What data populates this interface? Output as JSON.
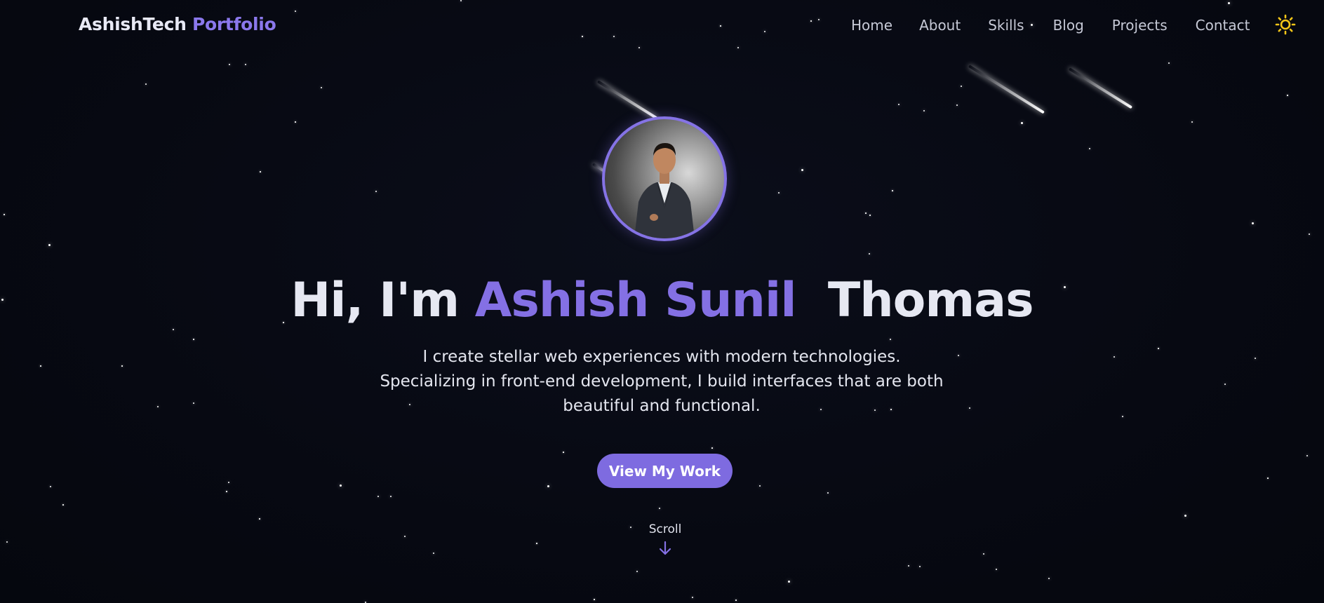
{
  "brand": {
    "part1": "AshishTech",
    "part2": "Portfolio"
  },
  "nav": {
    "items": [
      {
        "label": "Home"
      },
      {
        "label": "About"
      },
      {
        "label": "Skills"
      },
      {
        "label": "Blog"
      },
      {
        "label": "Projects"
      },
      {
        "label": "Contact"
      }
    ],
    "theme_icon": "sun-icon"
  },
  "hero": {
    "avatar_icon": "profile-photo",
    "title_prefix": "Hi, I'm ",
    "title_accent": "Ashish Sunil",
    "title_suffix": "Thomas",
    "description": "I create stellar web experiences with modern technologies. Specializing in front-end development, I build interfaces that are both beautiful and functional.",
    "cta_label": "View My Work",
    "scroll_label": "Scroll",
    "scroll_icon": "arrow-down-icon"
  },
  "colors": {
    "background": "#070912",
    "accent": "#8470e4",
    "button": "#7e6be0",
    "text": "#e6e8f2",
    "nav_text": "#c6c9d6",
    "sun": "#f5c518"
  }
}
